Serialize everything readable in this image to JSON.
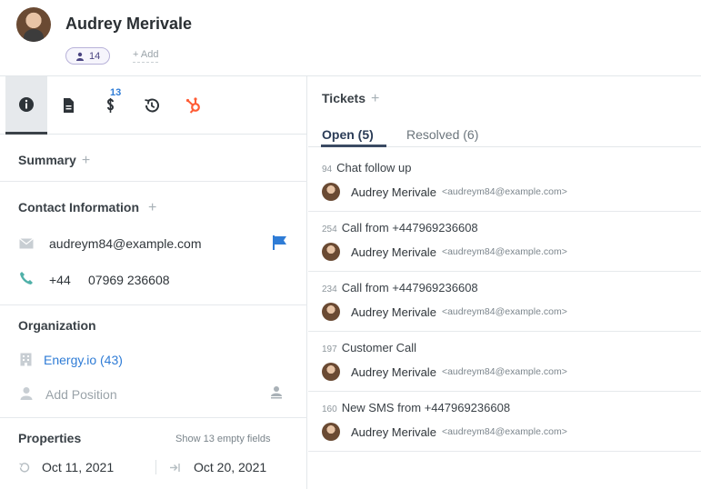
{
  "contact": {
    "name": "Audrey Merivale",
    "tag_count": "14",
    "add_label": "+ Add"
  },
  "left_tabs": {
    "badge": "13"
  },
  "summary": {
    "title": "Summary",
    "plus": "+"
  },
  "contact_info": {
    "title": "Contact Information",
    "plus": "+",
    "email": "audreym84@example.com",
    "phone_code": "+44",
    "phone_number": "07969 236608"
  },
  "organization": {
    "title": "Organization",
    "company": "Energy.io (43)",
    "position_placeholder": "Add Position"
  },
  "properties": {
    "title": "Properties",
    "empty_fields": "Show 13 empty fields",
    "created": "Oct 11, 2021",
    "updated": "Oct 20, 2021"
  },
  "tickets": {
    "title": "Tickets",
    "plus": "+",
    "tabs": [
      {
        "label": "Open (5)"
      },
      {
        "label": "Resolved (6)"
      }
    ],
    "items": [
      {
        "id": "94",
        "subject": "Chat follow up",
        "name": "Audrey Merivale",
        "email": "<audreym84@example.com>"
      },
      {
        "id": "254",
        "subject": "Call from +447969236608",
        "name": "Audrey Merivale",
        "email": "<audreym84@example.com>"
      },
      {
        "id": "234",
        "subject": "Call from +447969236608",
        "name": "Audrey Merivale",
        "email": "<audreym84@example.com>"
      },
      {
        "id": "197",
        "subject": "Customer Call",
        "name": "Audrey Merivale",
        "email": "<audreym84@example.com>"
      },
      {
        "id": "160",
        "subject": "New SMS from +447969236608",
        "name": "Audrey Merivale",
        "email": "<audreym84@example.com>"
      }
    ]
  },
  "colors": {
    "accent_blue": "#2f7cd6",
    "hubspot_orange": "#ff5c35",
    "phone_teal": "#4fb0a8",
    "tag_purple": "#4b4582"
  },
  "icons": {
    "tabs": [
      "info-icon",
      "document-icon",
      "link-icon",
      "history-icon",
      "hubspot-icon"
    ],
    "email": "envelope-icon",
    "phone": "phone-icon",
    "flag": "flag-icon",
    "company": "building-icon",
    "position": "person-icon"
  }
}
